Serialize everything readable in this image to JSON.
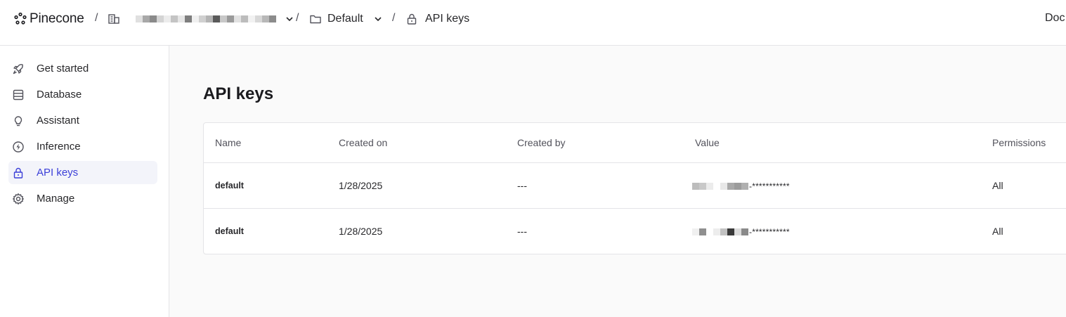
{
  "header": {
    "brand": "Pinecone",
    "separator": "/",
    "project": "Default",
    "current_page": "API keys",
    "right_link": "Doc"
  },
  "sidebar": {
    "items": [
      {
        "label": "Get started",
        "icon": "rocket-icon"
      },
      {
        "label": "Database",
        "icon": "database-icon"
      },
      {
        "label": "Assistant",
        "icon": "lightbulb-icon"
      },
      {
        "label": "Inference",
        "icon": "bolt-icon"
      },
      {
        "label": "API keys",
        "icon": "lock-icon",
        "active": true
      },
      {
        "label": "Manage",
        "icon": "gear-icon"
      }
    ]
  },
  "main": {
    "title": "API keys",
    "table": {
      "columns": [
        "Name",
        "Created on",
        "Created by",
        "Value",
        "Permissions"
      ],
      "rows": [
        {
          "name": "default",
          "created_on": "1/28/2025",
          "created_by": "---",
          "value_suffix": "-***********",
          "permissions": "All"
        },
        {
          "name": "default",
          "created_on": "1/28/2025",
          "created_by": "---",
          "value_suffix": "-***********",
          "permissions": "All"
        }
      ]
    }
  },
  "colors": {
    "accent": "#3b3fd8",
    "active_bg": "#f3f4fa",
    "border": "#e4e4e7",
    "main_bg": "#fafafa"
  }
}
